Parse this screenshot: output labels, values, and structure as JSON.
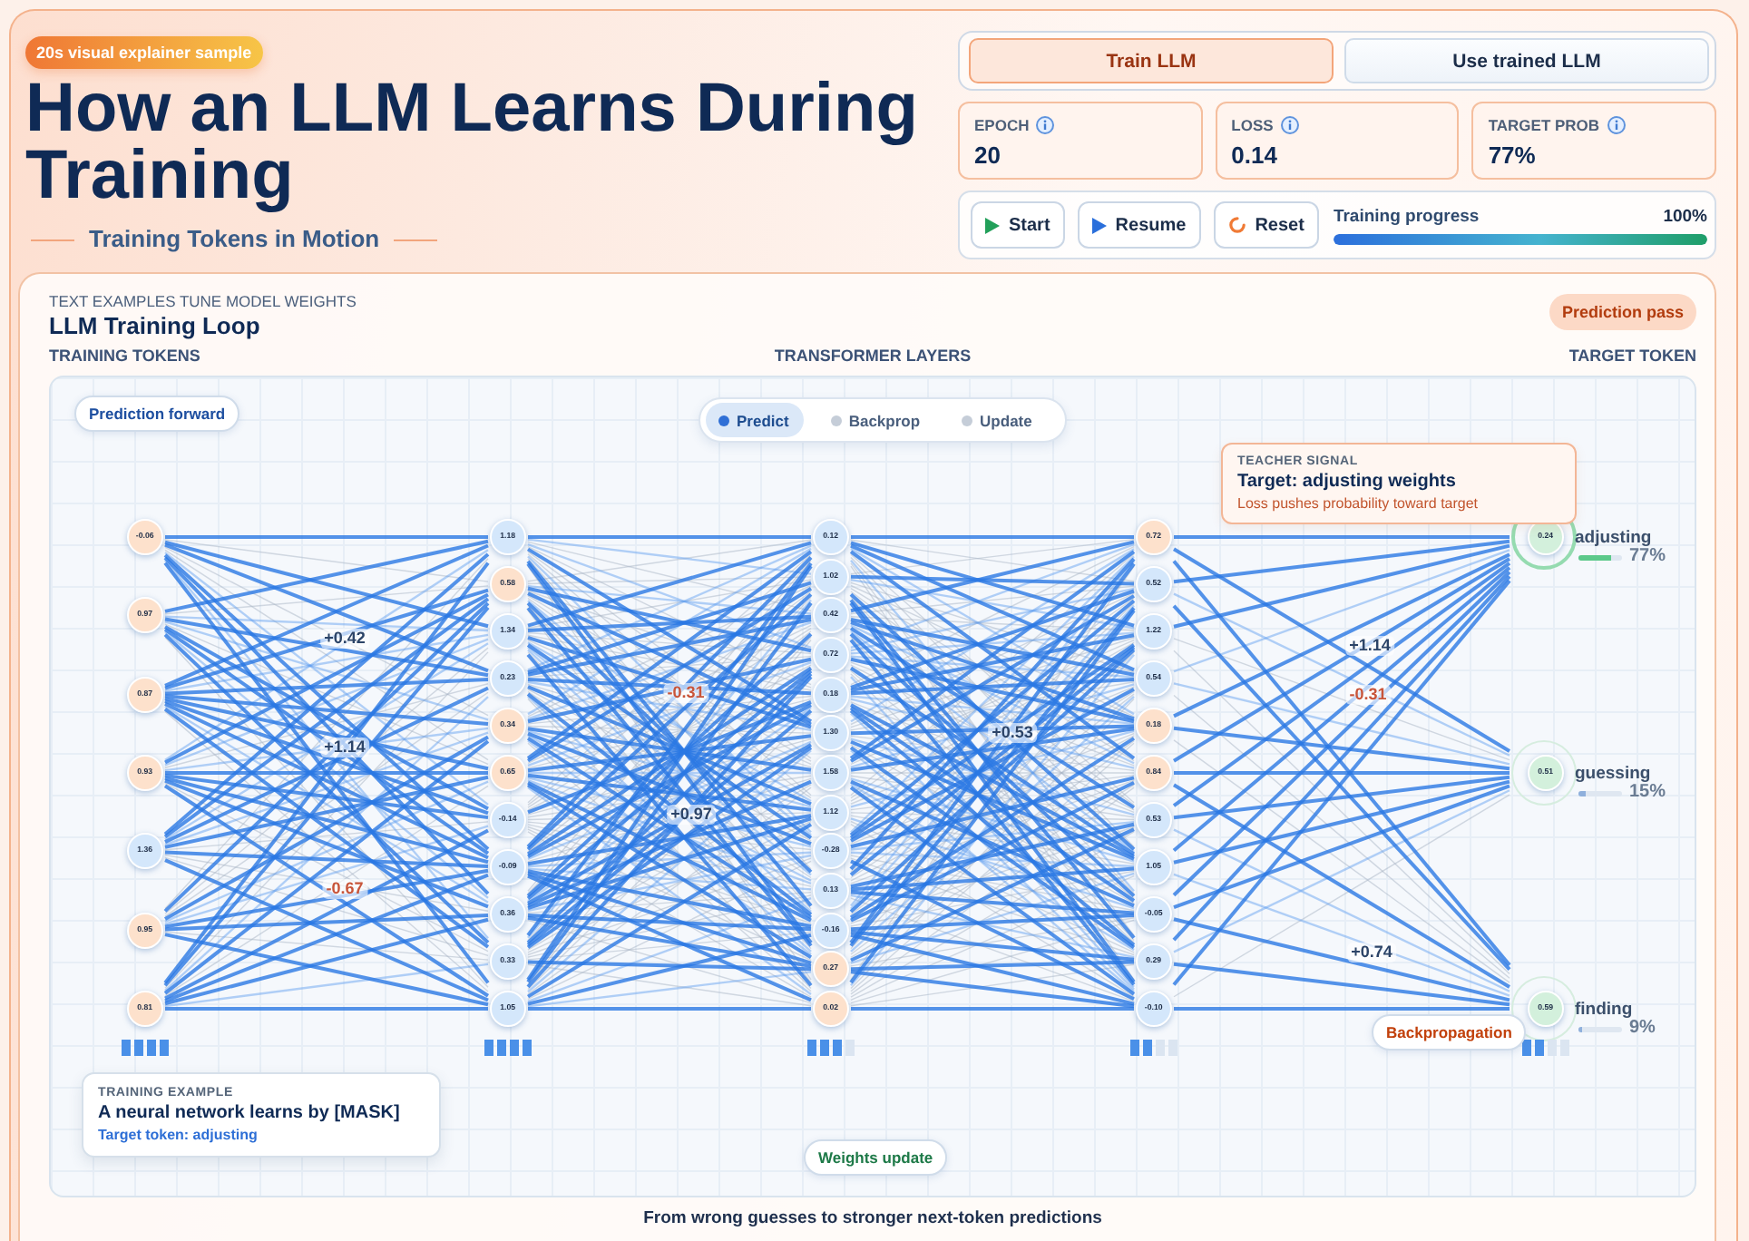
{
  "badge": "20s visual explainer sample",
  "title": "How an LLM Learns During Training",
  "subtitle": "Training Tokens in Motion",
  "modes": [
    {
      "label": "Train LLM",
      "selected": true
    },
    {
      "label": "Use trained LLM",
      "selected": false
    }
  ],
  "stats": [
    {
      "label": "EPOCH",
      "value": "20"
    },
    {
      "label": "LOSS",
      "value": "0.14"
    },
    {
      "label": "TARGET PROB",
      "value": "77%"
    }
  ],
  "controls": [
    {
      "label": "Start",
      "kind": "start"
    },
    {
      "label": "Resume",
      "kind": "resume"
    },
    {
      "label": "Reset",
      "kind": "reset"
    }
  ],
  "progress": {
    "label": "Training progress",
    "reading": "100%",
    "level": 1
  },
  "panel": {
    "eyebrow": "TEXT EXAMPLES TUNE MODEL WEIGHTS",
    "title": "LLM Training Loop",
    "pass_badge": "Prediction pass",
    "headings": [
      "TRAINING TOKENS",
      "TRANSFORMER LAYERS",
      "TARGET TOKEN"
    ],
    "stage_label": "Prediction forward",
    "phases": [
      {
        "label": "Predict",
        "selected": true
      },
      {
        "label": "Backprop",
        "selected": false
      },
      {
        "label": "Update",
        "selected": false
      }
    ],
    "teacher": {
      "eyebrow": "TEACHER SIGNAL",
      "title": "Target: adjusting weights",
      "note": "Loss pushes probability toward target"
    },
    "columns": [
      {
        "kind": "input",
        "meter": {
          "level": 1
        },
        "nodes": [
          {
            "value": "-0.06",
            "color": "#fde1cc"
          },
          {
            "value": "0.97",
            "color": "#fde1cc"
          },
          {
            "value": "0.87",
            "color": "#fde1cc"
          },
          {
            "value": "0.93",
            "color": "#fde1cc"
          },
          {
            "value": "1.36",
            "color": "#d4e7fb"
          },
          {
            "value": "0.95",
            "color": "#fde1cc"
          },
          {
            "value": "0.81",
            "color": "#fde1cc"
          }
        ]
      },
      {
        "kind": "hidden",
        "meter": {
          "level": 1
        },
        "nodes": [
          {
            "value": "1.18",
            "color": "#d4e7fb"
          },
          {
            "value": "0.58",
            "color": "#fde1cc"
          },
          {
            "value": "1.34",
            "color": "#d4e7fb"
          },
          {
            "value": "0.23",
            "color": "#d4e7fb"
          },
          {
            "value": "0.34",
            "color": "#fde1cc"
          },
          {
            "value": "0.65",
            "color": "#fde1cc"
          },
          {
            "value": "-0.14",
            "color": "#d4e7fb"
          },
          {
            "value": "-0.09",
            "color": "#d4e7fb"
          },
          {
            "value": "0.36",
            "color": "#d4e7fb"
          },
          {
            "value": "0.33",
            "color": "#d4e7fb"
          },
          {
            "value": "1.05",
            "color": "#d4e7fb"
          }
        ]
      },
      {
        "kind": "hidden",
        "meter": {
          "level": 0.75
        },
        "nodes": [
          {
            "value": "0.12",
            "color": "#d4e7fb"
          },
          {
            "value": "1.02",
            "color": "#d4e7fb"
          },
          {
            "value": "0.42",
            "color": "#d4e7fb"
          },
          {
            "value": "0.72",
            "color": "#d4e7fb"
          },
          {
            "value": "0.18",
            "color": "#d4e7fb"
          },
          {
            "value": "1.30",
            "color": "#d4e7fb"
          },
          {
            "value": "1.58",
            "color": "#d4e7fb"
          },
          {
            "value": "1.12",
            "color": "#d4e7fb"
          },
          {
            "value": "-0.28",
            "color": "#d4e7fb"
          },
          {
            "value": "0.13",
            "color": "#d4e7fb"
          },
          {
            "value": "-0.16",
            "color": "#d4e7fb"
          },
          {
            "value": "0.27",
            "color": "#fde1cc"
          },
          {
            "value": "0.02",
            "color": "#fde1cc"
          }
        ]
      },
      {
        "kind": "hidden",
        "meter": {
          "level": 0.5
        },
        "nodes": [
          {
            "value": "0.72",
            "color": "#fde1cc"
          },
          {
            "value": "0.52",
            "color": "#d4e7fb"
          },
          {
            "value": "1.22",
            "color": "#d4e7fb"
          },
          {
            "value": "0.54",
            "color": "#d4e7fb"
          },
          {
            "value": "0.18",
            "color": "#fde1cc"
          },
          {
            "value": "0.84",
            "color": "#fde1cc"
          },
          {
            "value": "0.53",
            "color": "#d4e7fb"
          },
          {
            "value": "1.05",
            "color": "#d4e7fb"
          },
          {
            "value": "-0.05",
            "color": "#d4e7fb"
          },
          {
            "value": "0.29",
            "color": "#d4e7fb"
          },
          {
            "value": "-0.10",
            "color": "#d4e7fb"
          }
        ]
      },
      {
        "kind": "output",
        "meter": {
          "level": 0.5
        },
        "nodes": [
          {
            "value": "0.24",
            "color": "#d3f0dc",
            "label": "adjusting",
            "prob": "77%",
            "level": 0.77,
            "selected": true
          },
          {
            "value": "0.51",
            "color": "#d3f0dc",
            "label": "guessing",
            "prob": "15%",
            "level": 0.15,
            "selected": false
          },
          {
            "value": "0.59",
            "color": "#d3f0dc",
            "label": "finding",
            "prob": "9%",
            "level": 0.09,
            "selected": false
          }
        ]
      }
    ],
    "weights": [
      {
        "text": "+0.42",
        "color": "#2c4468"
      },
      {
        "text": "+1.14",
        "color": "#2c4468"
      },
      {
        "text": "-0.67",
        "color": "#c8553a"
      },
      {
        "text": "-0.31",
        "color": "#c8553a"
      },
      {
        "text": "+0.97",
        "color": "#2c4468"
      },
      {
        "text": "+0.53",
        "color": "#2c4468"
      },
      {
        "text": "+1.14",
        "color": "#2c4468"
      },
      {
        "text": "-0.31",
        "color": "#c8553a"
      },
      {
        "text": "+0.74",
        "color": "#2c4468"
      }
    ],
    "example": {
      "eyebrow": "TRAINING EXAMPLE",
      "sentence": "A neural network learns by [MASK]",
      "target": "Target token: adjusting"
    },
    "update_label": "Weights update",
    "backprop_label": "Backpropagation",
    "footer": "From wrong guesses to stronger next-token predictions"
  }
}
